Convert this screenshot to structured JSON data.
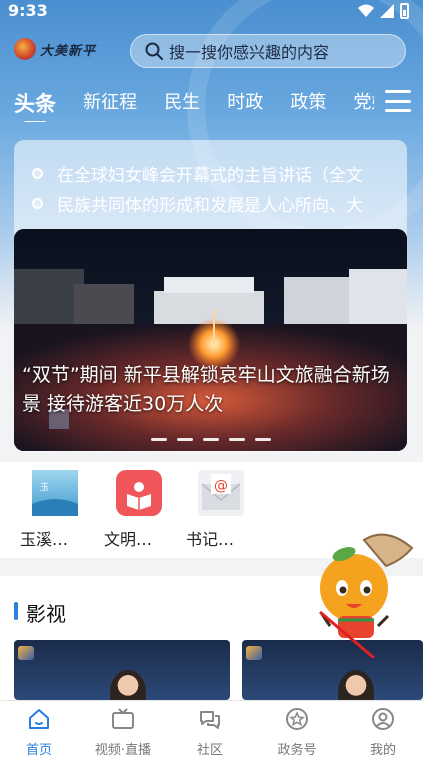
{
  "status_bar": {
    "time": "9:33"
  },
  "header": {
    "logo_text": "大美新平",
    "search_placeholder": "搜一搜你感兴趣的内容"
  },
  "channels": [
    "头条",
    "新征程",
    "民生",
    "时政",
    "政策",
    "党媒"
  ],
  "ticker": [
    "在全球妇女峰会开幕式的主旨讲话（全文",
    "民族共同体的形成和发展是人心所向、大"
  ],
  "banner": {
    "caption": "“双节”期间 新平县解锁哀牢山文旅融合新场景 接待游客近30万人次",
    "slide_count": 5
  },
  "apps": [
    {
      "label": "玉溪…",
      "icon": "yuxi-news-app-icon"
    },
    {
      "label": "文明…",
      "icon": "civilization-book-app-icon"
    },
    {
      "label": "书记…",
      "icon": "mailbox-envelope-app-icon"
    }
  ],
  "section": {
    "title": "影视"
  },
  "tabbar": [
    {
      "label": "首页",
      "icon": "home-icon",
      "active": true
    },
    {
      "label": "视频·直播",
      "icon": "tv-icon",
      "active": false
    },
    {
      "label": "社区",
      "icon": "chat-bubbles-icon",
      "active": false
    },
    {
      "label": "政务号",
      "icon": "badge-star-icon",
      "active": false
    },
    {
      "label": "我的",
      "icon": "profile-icon",
      "active": false
    }
  ],
  "colors": {
    "accent": "#2a7de1",
    "header_blue": "#4a8fd0"
  }
}
